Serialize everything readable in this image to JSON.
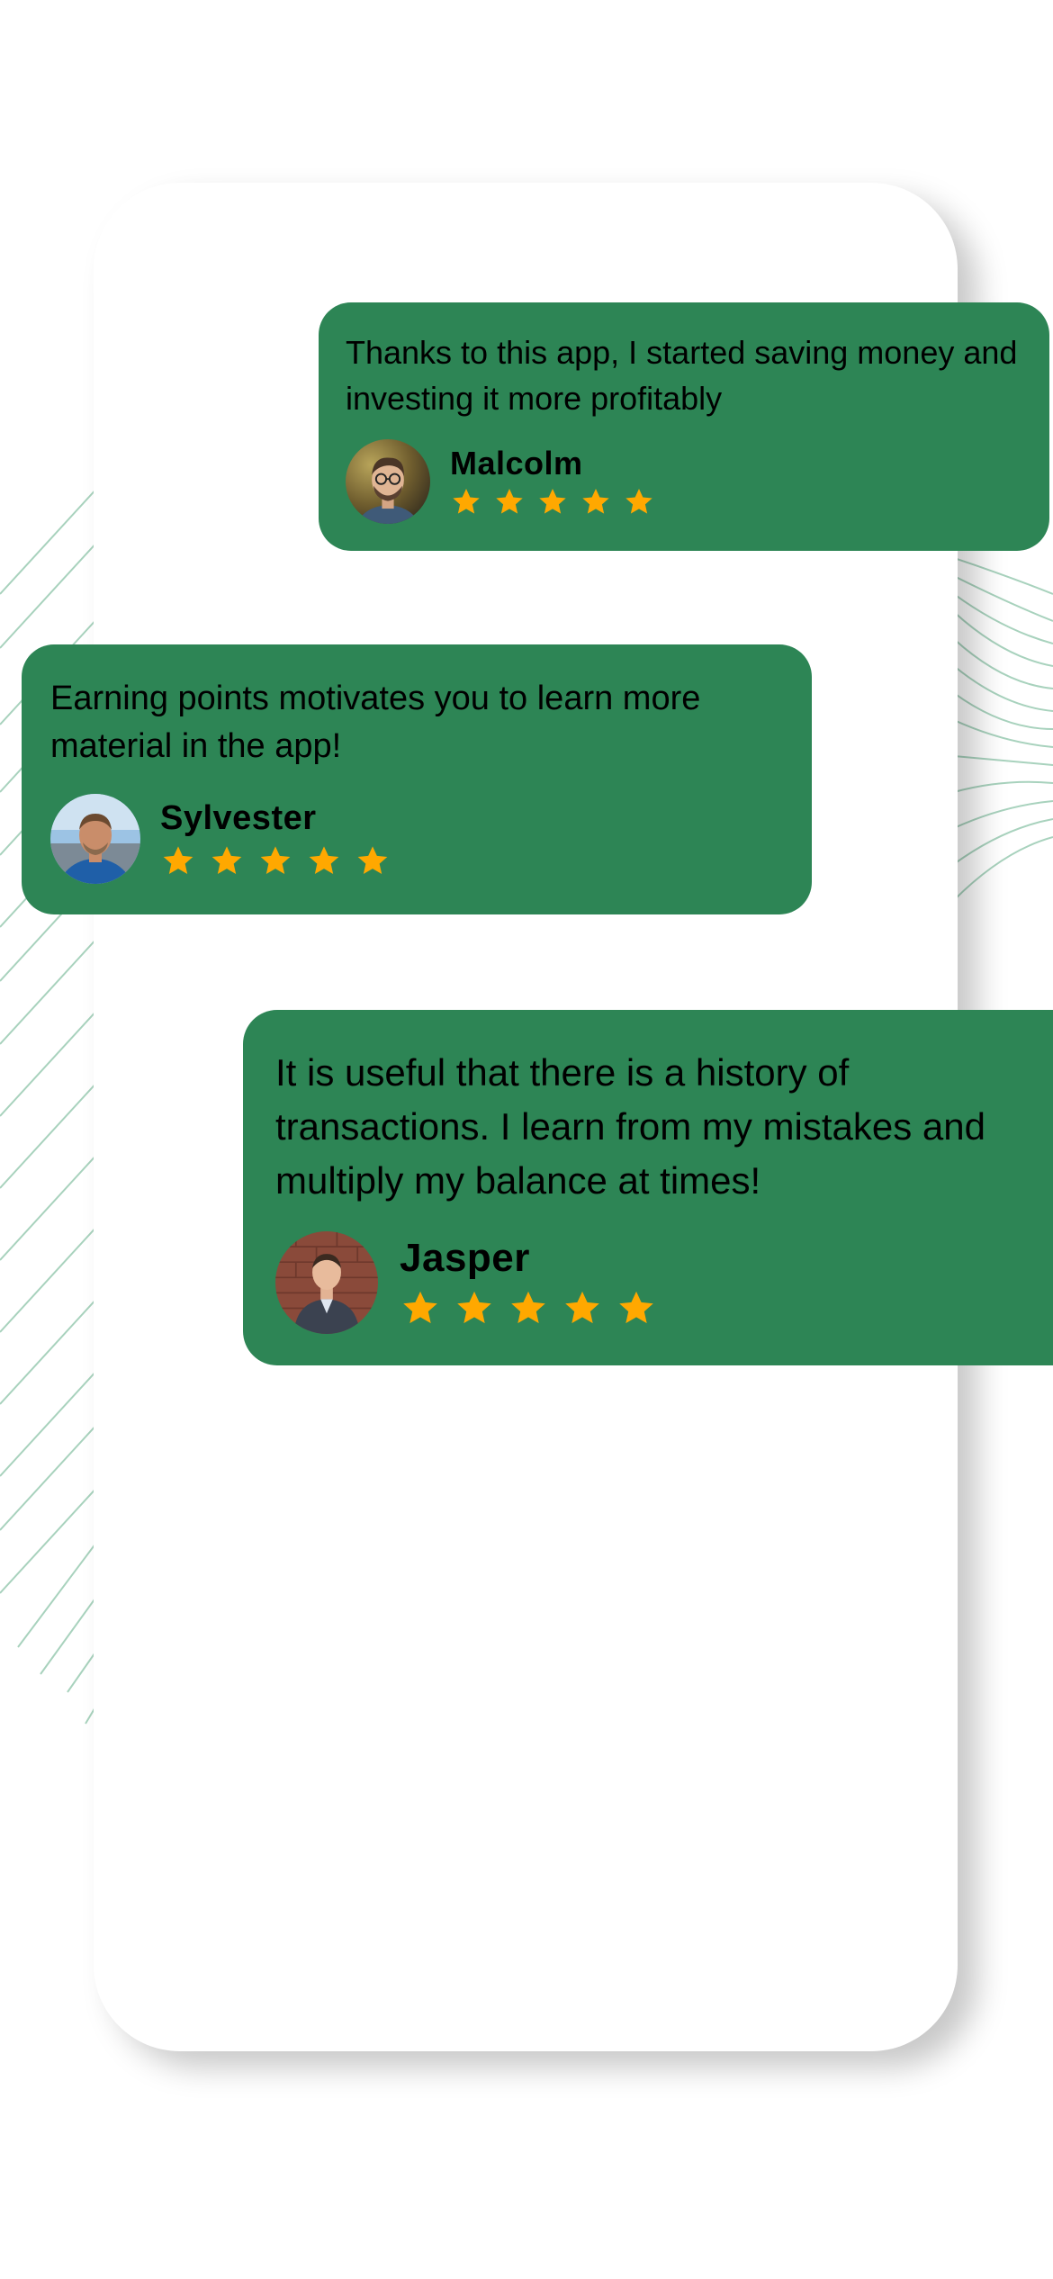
{
  "colors": {
    "card_background": "#2d8555",
    "star": "#ffa800",
    "decor_lines": "#a8d2bd"
  },
  "testimonials": [
    {
      "text": "Thanks to this app, I started saving money and investing it more profitably",
      "name": "Malcolm",
      "rating": 5,
      "avatar_icon": "man-with-glasses-avatar"
    },
    {
      "text": "Earning points motivates you to learn more material in the app!",
      "name": "Sylvester",
      "rating": 5,
      "avatar_icon": "man-blue-jacket-avatar"
    },
    {
      "text": "It is useful that there is a history of transactions. I learn from my mistakes and multiply my balance at times!",
      "name": "Jasper",
      "rating": 5,
      "avatar_icon": "man-in-suit-avatar"
    }
  ]
}
